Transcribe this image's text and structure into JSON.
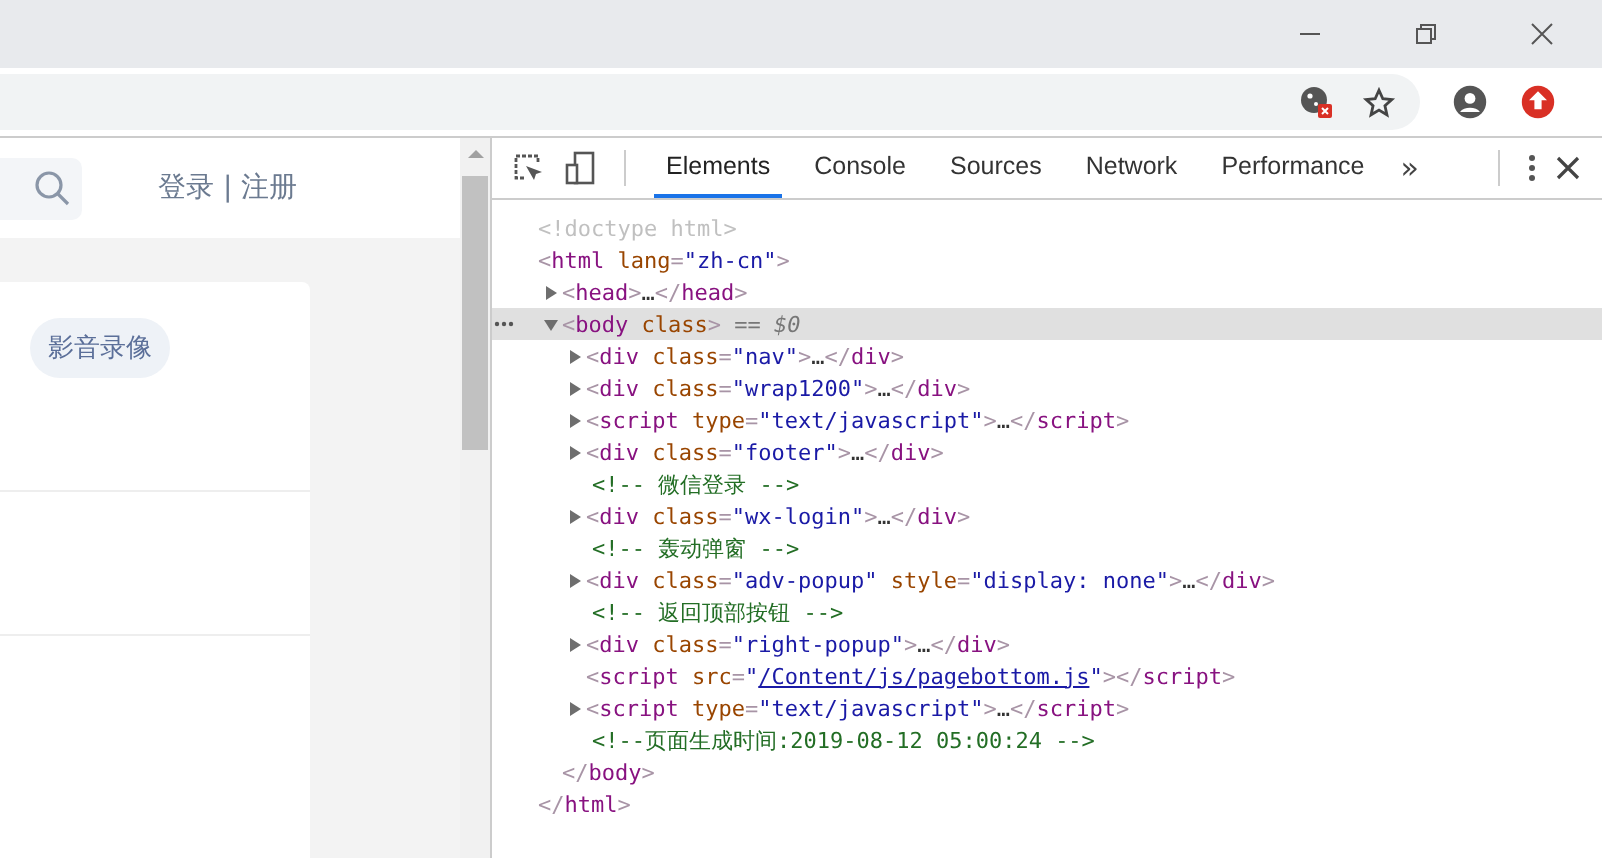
{
  "page": {
    "auth_links": "登录 | 注册",
    "tag": "影音录像"
  },
  "devtools": {
    "tabs": [
      {
        "label": "Elements",
        "selected": true
      },
      {
        "label": "Console",
        "selected": false
      },
      {
        "label": "Sources",
        "selected": false
      },
      {
        "label": "Network",
        "selected": false
      },
      {
        "label": "Performance",
        "selected": false
      }
    ],
    "overflow": "»",
    "dom": [
      {
        "selected": false,
        "tokens": [
          {
            "doctype": "<!doctype html>"
          }
        ]
      },
      {
        "selected": false,
        "tokens": [
          {
            "punct": "<"
          },
          {
            "tag": "html"
          },
          {
            "attr": " lang"
          },
          {
            "punct": "="
          },
          {
            "value": "\"zh-cn\""
          },
          {
            "punct": ">"
          }
        ],
        "close": [
          {
            "punct": "</"
          },
          {
            "tag": "html"
          },
          {
            "punct": ">"
          }
        ],
        "children": [
          {
            "selected": false,
            "expanded": false,
            "tokens": [
              {
                "punct": "<"
              },
              {
                "tag": "head"
              },
              {
                "punct": ">"
              },
              {
                "ellipsis": "…"
              },
              {
                "punct": "</"
              },
              {
                "tag": "head"
              },
              {
                "punct": ">"
              }
            ]
          },
          {
            "selected": true,
            "expanded": true,
            "tokens": [
              {
                "punct": "<"
              },
              {
                "tag": "body"
              },
              {
                "attr": " class"
              },
              {
                "punct": ">"
              },
              {
                "marker": " == $0"
              }
            ],
            "close": [
              {
                "punct": "</"
              },
              {
                "tag": "body"
              },
              {
                "punct": ">"
              }
            ],
            "children": [
              {
                "selected": false,
                "expanded": false,
                "tokens": [
                  {
                    "punct": "<"
                  },
                  {
                    "tag": "div"
                  },
                  {
                    "attr": " class"
                  },
                  {
                    "punct": "="
                  },
                  {
                    "value": "\"nav\""
                  },
                  {
                    "punct": ">"
                  },
                  {
                    "ellipsis": "…"
                  },
                  {
                    "punct": "</"
                  },
                  {
                    "tag": "div"
                  },
                  {
                    "punct": ">"
                  }
                ]
              },
              {
                "selected": false,
                "expanded": false,
                "tokens": [
                  {
                    "punct": "<"
                  },
                  {
                    "tag": "div"
                  },
                  {
                    "attr": " class"
                  },
                  {
                    "punct": "="
                  },
                  {
                    "value": "\"wrap1200\""
                  },
                  {
                    "punct": ">"
                  },
                  {
                    "ellipsis": "…"
                  },
                  {
                    "punct": "</"
                  },
                  {
                    "tag": "div"
                  },
                  {
                    "punct": ">"
                  }
                ]
              },
              {
                "selected": false,
                "expanded": false,
                "tokens": [
                  {
                    "punct": "<"
                  },
                  {
                    "tag": "script"
                  },
                  {
                    "attr": " type"
                  },
                  {
                    "punct": "="
                  },
                  {
                    "value": "\"text/javascript\""
                  },
                  {
                    "punct": ">"
                  },
                  {
                    "ellipsis": "…"
                  },
                  {
                    "punct": "</"
                  },
                  {
                    "tag": "script"
                  },
                  {
                    "punct": ">"
                  }
                ]
              },
              {
                "selected": false,
                "expanded": false,
                "tokens": [
                  {
                    "punct": "<"
                  },
                  {
                    "tag": "div"
                  },
                  {
                    "attr": " class"
                  },
                  {
                    "punct": "="
                  },
                  {
                    "value": "\"footer\""
                  },
                  {
                    "punct": ">"
                  },
                  {
                    "ellipsis": "…"
                  },
                  {
                    "punct": "</"
                  },
                  {
                    "tag": "div"
                  },
                  {
                    "punct": ">"
                  }
                ]
              },
              {
                "selected": false,
                "tokens": [
                  {
                    "comment": "<!-- 微信登录 -->"
                  }
                ]
              },
              {
                "selected": false,
                "expanded": false,
                "tokens": [
                  {
                    "punct": "<"
                  },
                  {
                    "tag": "div"
                  },
                  {
                    "attr": " class"
                  },
                  {
                    "punct": "="
                  },
                  {
                    "value": "\"wx-login\""
                  },
                  {
                    "punct": ">"
                  },
                  {
                    "ellipsis": "…"
                  },
                  {
                    "punct": "</"
                  },
                  {
                    "tag": "div"
                  },
                  {
                    "punct": ">"
                  }
                ]
              },
              {
                "selected": false,
                "tokens": [
                  {
                    "comment": "<!-- 轰动弹窗 -->"
                  }
                ]
              },
              {
                "selected": false,
                "expanded": false,
                "tokens": [
                  {
                    "punct": "<"
                  },
                  {
                    "tag": "div"
                  },
                  {
                    "attr": " class"
                  },
                  {
                    "punct": "="
                  },
                  {
                    "value": "\"adv-popup\""
                  },
                  {
                    "attr": " style"
                  },
                  {
                    "punct": "="
                  },
                  {
                    "value": "\"display: none\""
                  },
                  {
                    "punct": ">"
                  },
                  {
                    "ellipsis": "…"
                  },
                  {
                    "punct": "</"
                  },
                  {
                    "tag": "div"
                  },
                  {
                    "punct": ">"
                  }
                ]
              },
              {
                "selected": false,
                "tokens": [
                  {
                    "comment": "<!-- 返回顶部按钮 -->"
                  }
                ]
              },
              {
                "selected": false,
                "expanded": false,
                "tokens": [
                  {
                    "punct": "<"
                  },
                  {
                    "tag": "div"
                  },
                  {
                    "attr": " class"
                  },
                  {
                    "punct": "="
                  },
                  {
                    "value": "\"right-popup\""
                  },
                  {
                    "punct": ">"
                  },
                  {
                    "ellipsis": "…"
                  },
                  {
                    "punct": "</"
                  },
                  {
                    "tag": "div"
                  },
                  {
                    "punct": ">"
                  }
                ]
              },
              {
                "selected": false,
                "tokens": [
                  {
                    "punct": "<"
                  },
                  {
                    "tag": "script"
                  },
                  {
                    "attr": " src"
                  },
                  {
                    "punct": "="
                  },
                  {
                    "value": "\""
                  },
                  {
                    "link": "/Content/js/pagebottom.js"
                  },
                  {
                    "value": "\""
                  },
                  {
                    "punct": ">"
                  },
                  {
                    "punct": "</"
                  },
                  {
                    "tag": "script"
                  },
                  {
                    "punct": ">"
                  }
                ]
              },
              {
                "selected": false,
                "expanded": false,
                "tokens": [
                  {
                    "punct": "<"
                  },
                  {
                    "tag": "script"
                  },
                  {
                    "attr": " type"
                  },
                  {
                    "punct": "="
                  },
                  {
                    "value": "\"text/javascript\""
                  },
                  {
                    "punct": ">"
                  },
                  {
                    "ellipsis": "…"
                  },
                  {
                    "punct": "</"
                  },
                  {
                    "tag": "script"
                  },
                  {
                    "punct": ">"
                  }
                ]
              },
              {
                "selected": false,
                "tokens": [
                  {
                    "comment": "<!--页面生成时间:2019-08-12 05:00:24 -->"
                  }
                ]
              }
            ]
          }
        ]
      }
    ]
  }
}
